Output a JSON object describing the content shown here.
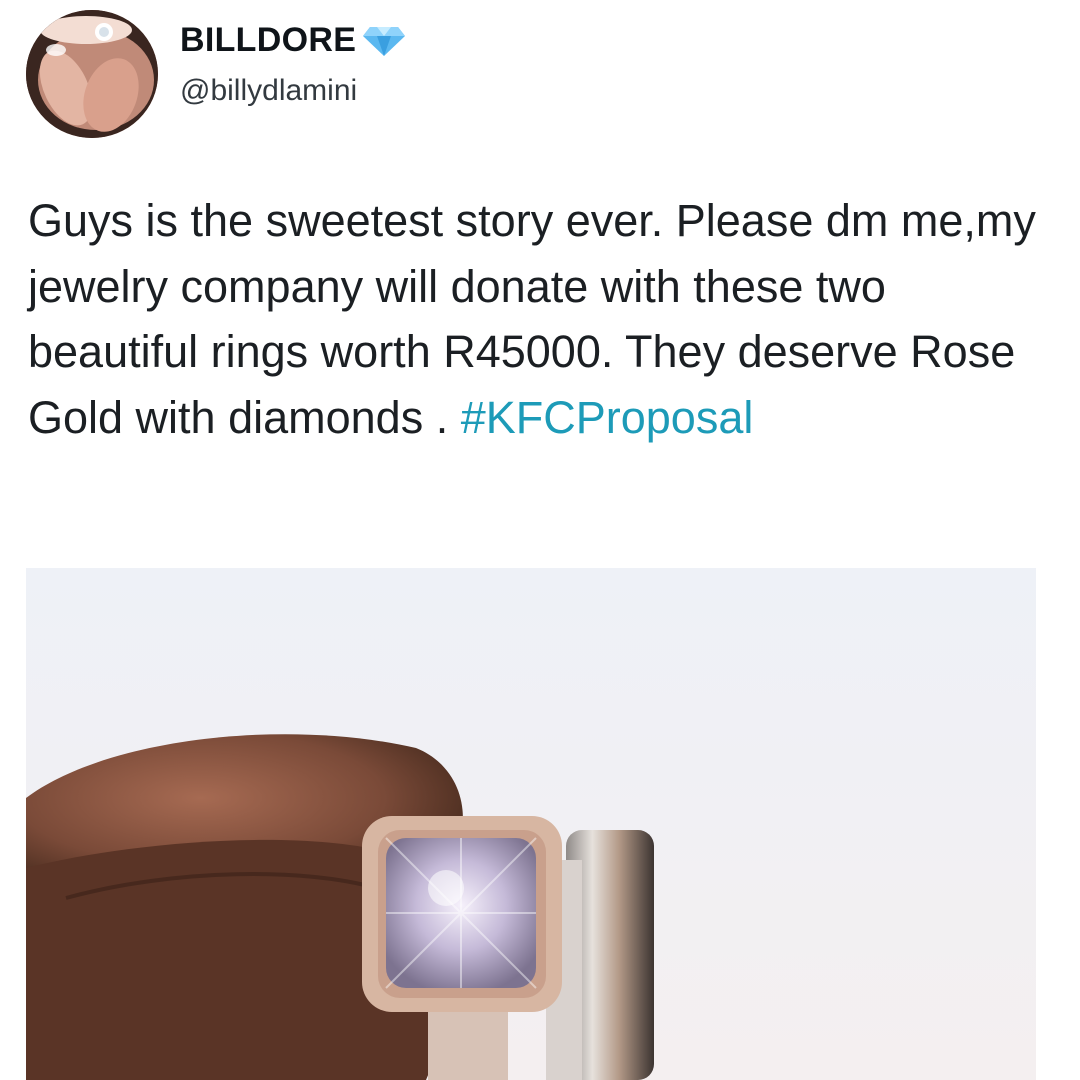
{
  "tweet": {
    "author": {
      "display_name": "BILLDORE",
      "handle": "@billydlamini",
      "badge_icon": "diamond-icon",
      "badge_color": "#5bb8f0"
    },
    "text_parts": [
      "Guys is the sweetest story ever. Please dm me,my jewelry company will donate with these two beautiful rings worth R45000. They deserve Rose Gold with diamonds . "
    ],
    "hashtag": "#KFCProposal",
    "hashtag_color": "#1d9bb8"
  }
}
